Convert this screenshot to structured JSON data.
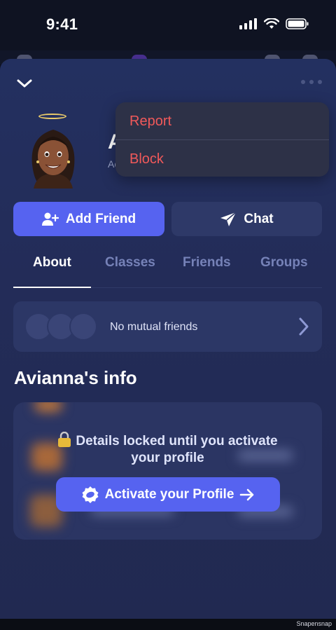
{
  "status_bar": {
    "time": "9:41"
  },
  "menu": {
    "report_label": "Report",
    "block_label": "Block"
  },
  "profile": {
    "name_initial": "A",
    "subtitle_initial": "Ac"
  },
  "actions": {
    "add_friend_label": "Add Friend",
    "chat_label": "Chat"
  },
  "tabs": [
    {
      "label": "About",
      "active": true
    },
    {
      "label": "Classes",
      "active": false
    },
    {
      "label": "Friends",
      "active": false
    },
    {
      "label": "Groups",
      "active": false
    }
  ],
  "mutual": {
    "text": "No mutual friends"
  },
  "info": {
    "title": "Avianna's info",
    "locked_line1": "Details locked until you activate",
    "locked_line2": "your profile",
    "activate_label": "Activate your Profile"
  },
  "footer": {
    "brand": "Snapensnap"
  },
  "colors": {
    "accent": "#5663f0",
    "danger": "#f0595a",
    "sheet": "#232c58"
  }
}
